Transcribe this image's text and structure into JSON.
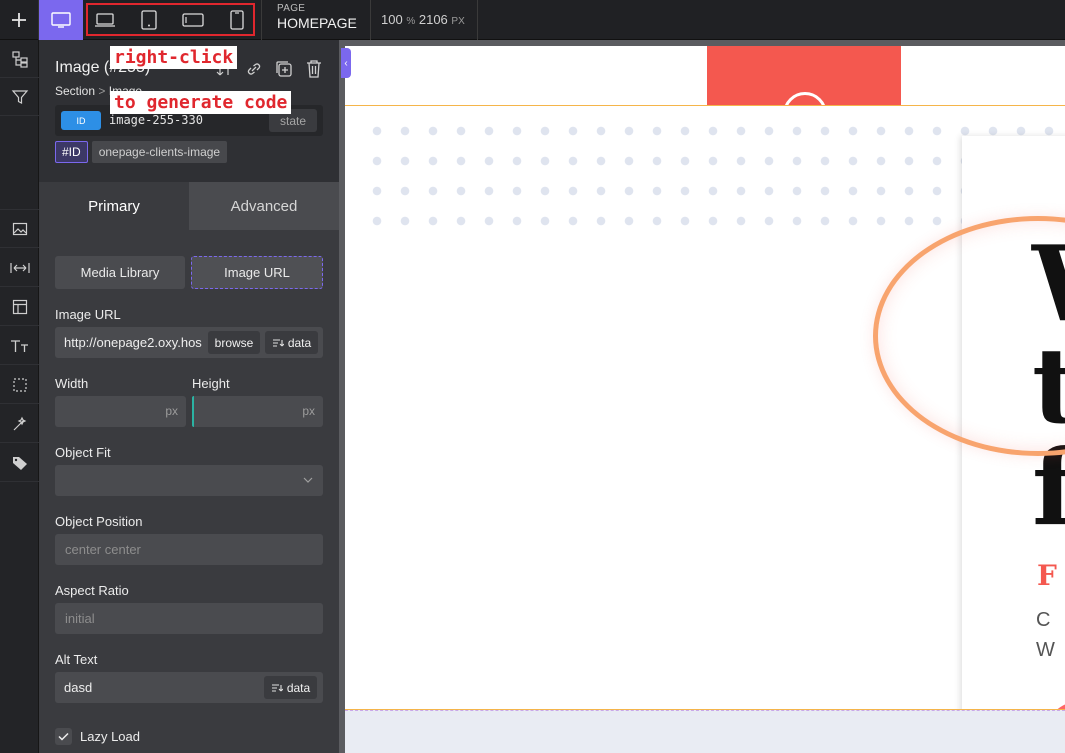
{
  "topbar": {
    "page_label": "PAGE",
    "page_name": "HOMEPAGE",
    "zoom_value": "100",
    "zoom_unit": "%",
    "width_value": "2106",
    "width_unit": "PX",
    "devices": [
      "desktop-icon",
      "laptop-icon",
      "tablet-icon",
      "tablet-landscape-icon",
      "phone-icon"
    ]
  },
  "annotations": {
    "line1": "right-click",
    "line2": "to generate code"
  },
  "element": {
    "title": "Image (#255)",
    "breadcrumb_parent": "Section",
    "breadcrumb_sep": ">",
    "breadcrumb_child": "Image",
    "id_badge": "ID",
    "id_value": "image-255-330",
    "state_label": "state",
    "id_tag": "#ID",
    "class_tag": "onepage-clients-image"
  },
  "tabs": {
    "primary": "Primary",
    "advanced": "Advanced"
  },
  "source": {
    "media_library": "Media Library",
    "image_url": "Image URL"
  },
  "fields": {
    "image_url_label": "Image URL",
    "image_url_value": "http://onepage2.oxy.hos",
    "browse_label": "browse",
    "data_label": "data",
    "width_label": "Width",
    "height_label": "Height",
    "px_unit": "px",
    "object_fit_label": "Object Fit",
    "object_position_label": "Object Position",
    "object_position_placeholder": "center center",
    "aspect_ratio_label": "Aspect Ratio",
    "aspect_ratio_placeholder": "initial",
    "alt_text_label": "Alt Text",
    "alt_text_value": "dasd",
    "lazy_load_label": "Lazy Load"
  },
  "canvas": {
    "hero_letters": [
      "W",
      "t",
      "f"
    ],
    "hero_sub": "F",
    "hero_p1": "C",
    "hero_p2": "W"
  },
  "colors": {
    "accent": "#7b68ee",
    "id_badge": "#2d8fe6",
    "annotation_red": "#e0272e",
    "hero_red": "#f4584f",
    "ring_orange": "#f8a46e"
  }
}
